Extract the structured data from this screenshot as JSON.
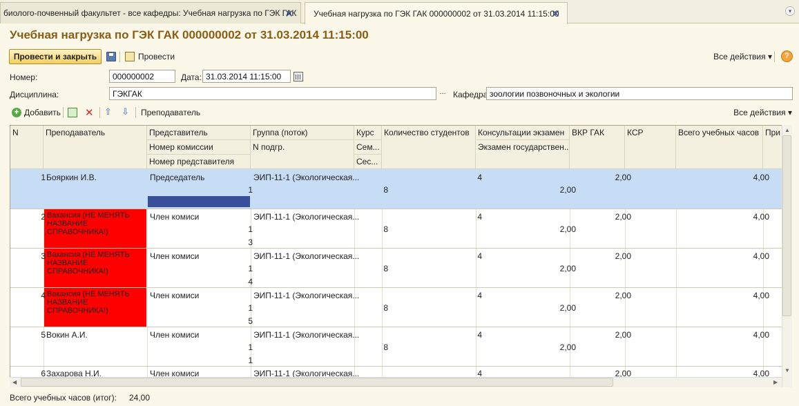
{
  "tabs": [
    {
      "label": "биолого-почвенный факультет - все кафедры: Учебная нагрузка по ГЭК ГАК",
      "close": "✕"
    },
    {
      "label": "Учебная нагрузка по ГЭК ГАК 000000002 от 31.03.2014 11:15:00",
      "close": "✕"
    }
  ],
  "title": "Учебная нагрузка по ГЭК ГАК 000000002 от 31.03.2014 11:15:00",
  "toolbar": {
    "post_close": "Провести и закрыть",
    "post": "Провести",
    "all_actions": "Все действия ▾",
    "help": "?"
  },
  "form": {
    "number_label": "Номер:",
    "number_value": "000000002",
    "date_label": "Дата:",
    "date_value": "31.03.2014 11:15:00",
    "discipline_label": "Дисциплина:",
    "discipline_value": "ГЭКГАК",
    "dots": "...",
    "department_label": "Кафедра:",
    "department_value": "зоологии позвоночных и экологии"
  },
  "table_toolbar": {
    "add": "Добавить",
    "teacher": "Преподаватель",
    "all_actions": "Все действия ▾"
  },
  "columns": {
    "n": "N",
    "teacher": "Преподаватель",
    "rep": "Представитель",
    "rep_commission": "Номер комиссии",
    "rep_number": "Номер представителя",
    "group": "Группа (поток)",
    "subgroup": "N подгр.",
    "course": "Курс",
    "semester": "Сем...",
    "session": "Сес...",
    "students": "Количество студентов",
    "consult": "Консультации экзамен",
    "state_exam": "Экзамен государствен...",
    "vkr": "ВКР ГАК",
    "ksr": "КСР",
    "total": "Всего учебных часов",
    "note": "При"
  },
  "rows": [
    {
      "n": "1",
      "teacher": "Бояркин И.В.",
      "rep": "Председатель",
      "commission": "1",
      "rep_no": "",
      "group": "ЭИП-11-1 (Экологическая...",
      "semester": "8",
      "students": "4",
      "state_exam": "2,00",
      "vkr": "2,00",
      "total": "4,00"
    },
    {
      "n": "2",
      "teacher": "Вакансия (НЕ МЕНЯТЬ НАЗВАНИЕ СПРАВОЧНИКА!)",
      "rep": "Член комиси",
      "commission": "1",
      "rep_no": "3",
      "group": "ЭИП-11-1 (Экологическая...",
      "semester": "8",
      "students": "4",
      "state_exam": "2,00",
      "vkr": "2,00",
      "total": "4,00"
    },
    {
      "n": "3",
      "teacher": "Вакансия (НЕ МЕНЯТЬ НАЗВАНИЕ СПРАВОЧНИКА!)",
      "rep": "Член комиси",
      "commission": "1",
      "rep_no": "4",
      "group": "ЭИП-11-1 (Экологическая...",
      "semester": "8",
      "students": "4",
      "state_exam": "2,00",
      "vkr": "2,00",
      "total": "4,00"
    },
    {
      "n": "4",
      "teacher": "Вакансия (НЕ МЕНЯТЬ НАЗВАНИЕ СПРАВОЧНИКА!)",
      "rep": "Член комиси",
      "commission": "1",
      "rep_no": "5",
      "group": "ЭИП-11-1 (Экологическая...",
      "semester": "8",
      "students": "4",
      "state_exam": "2,00",
      "vkr": "2,00",
      "total": "4,00"
    },
    {
      "n": "5",
      "teacher": "Вокин А.И.",
      "rep": "Член комиси",
      "commission": "1",
      "rep_no": "1",
      "group": "ЭИП-11-1 (Экологическая...",
      "semester": "8",
      "students": "4",
      "state_exam": "2,00",
      "vkr": "2,00",
      "total": "4,00"
    },
    {
      "n": "6",
      "teacher": "Захарова Н.И.",
      "rep": "Член комиси",
      "commission": "",
      "rep_no": "",
      "group": "ЭИП-11-1 (Экологическая...",
      "semester": "",
      "students": "4",
      "state_exam": "",
      "vkr": "2,00",
      "total": "4,00"
    }
  ],
  "footer": {
    "label": "Всего учебных часов (итог):",
    "value": "24,00"
  },
  "colors": {
    "accent_title": "#8a5d14",
    "selected_row": "#c7dcf5",
    "vacancy_red": "#ff0000"
  }
}
